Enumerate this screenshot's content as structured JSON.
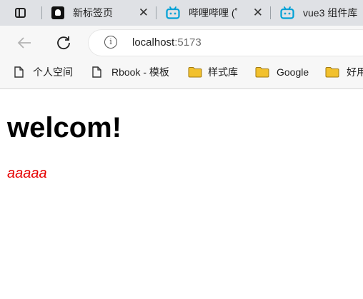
{
  "tabs": [
    {
      "title": "新标签页",
      "favicon": "notion-icon",
      "close": "✕"
    },
    {
      "title": "哔哩哔哩 (゜",
      "favicon": "bilibili-icon",
      "close": "✕"
    },
    {
      "title": "vue3 组件库",
      "favicon": "bilibili-icon",
      "close": "✕"
    }
  ],
  "address_bar": {
    "host": "localhost",
    "port": ":5173"
  },
  "bookmarks": [
    {
      "label": "个人空间",
      "icon": "page-icon"
    },
    {
      "label": "Rbook - 模板",
      "icon": "page-icon"
    },
    {
      "label": "样式库",
      "icon": "folder-icon"
    },
    {
      "label": "Google",
      "icon": "folder-icon"
    },
    {
      "label": "好用",
      "icon": "folder-icon"
    }
  ],
  "page": {
    "heading": "welcom!",
    "text": "aaaaa"
  },
  "colors": {
    "folder": "#f2c12e",
    "bilibili": "#00a1d6",
    "red_text": "#e60000"
  }
}
